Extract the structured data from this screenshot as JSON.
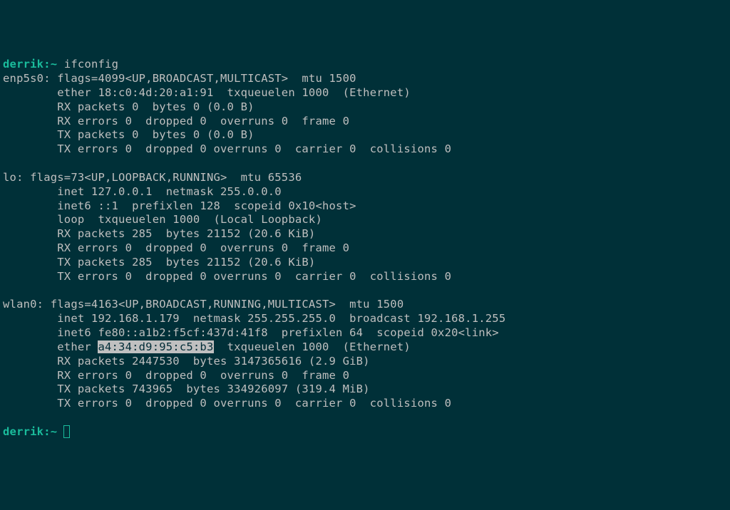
{
  "prompt": {
    "user": "derrik",
    "sep": ":",
    "path": "~",
    "end": " "
  },
  "command1": "ifconfig",
  "enp5s0": {
    "header": "enp5s0: flags=4099<UP,BROADCAST,MULTICAST>  mtu 1500",
    "l1": "        ether 18:c0:4d:20:a1:91  txqueuelen 1000  (Ethernet)",
    "l2": "        RX packets 0  bytes 0 (0.0 B)",
    "l3": "        RX errors 0  dropped 0  overruns 0  frame 0",
    "l4": "        TX packets 0  bytes 0 (0.0 B)",
    "l5": "        TX errors 0  dropped 0 overruns 0  carrier 0  collisions 0"
  },
  "lo": {
    "header": "lo: flags=73<UP,LOOPBACK,RUNNING>  mtu 65536",
    "l1": "        inet 127.0.0.1  netmask 255.0.0.0",
    "l2": "        inet6 ::1  prefixlen 128  scopeid 0x10<host>",
    "l3": "        loop  txqueuelen 1000  (Local Loopback)",
    "l4": "        RX packets 285  bytes 21152 (20.6 KiB)",
    "l5": "        RX errors 0  dropped 0  overruns 0  frame 0",
    "l6": "        TX packets 285  bytes 21152 (20.6 KiB)",
    "l7": "        TX errors 0  dropped 0 overruns 0  carrier 0  collisions 0"
  },
  "wlan0": {
    "header": "wlan0: flags=4163<UP,BROADCAST,RUNNING,MULTICAST>  mtu 1500",
    "l1": "        inet 192.168.1.179  netmask 255.255.255.0  broadcast 192.168.1.255",
    "l2": "        inet6 fe80::a1b2:f5cf:437d:41f8  prefixlen 64  scopeid 0x20<link>",
    "l3a": "        ether ",
    "l3_hl": "a4:34:d9:95:c5:b3",
    "l3b": "  txqueuelen 1000  (Ethernet)",
    "l4": "        RX packets 2447530  bytes 3147365616 (2.9 GiB)",
    "l5": "        RX errors 0  dropped 0  overruns 0  frame 0",
    "l6": "        TX packets 743965  bytes 334926097 (319.4 MiB)",
    "l7": "        TX errors 0  dropped 0 overruns 0  carrier 0  collisions 0"
  }
}
